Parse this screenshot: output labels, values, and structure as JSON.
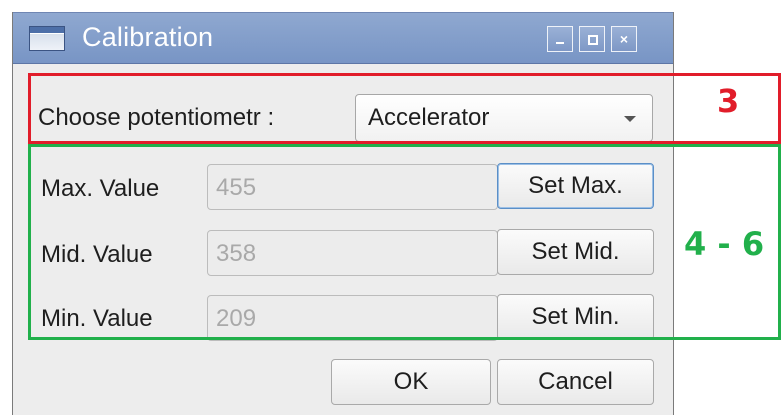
{
  "window": {
    "title": "Calibration",
    "controls": {
      "minimize": "minimize",
      "maximize": "maximize",
      "close": "×"
    }
  },
  "potentiometer": {
    "label": "Choose potentiometr :",
    "selected": "Accelerator"
  },
  "values": [
    {
      "label": "Max. Value",
      "value": "455",
      "button": "Set Max."
    },
    {
      "label": "Mid. Value",
      "value": "358",
      "button": "Set Mid."
    },
    {
      "label": "Min. Value",
      "value": "209",
      "button": "Set Min."
    }
  ],
  "footer": {
    "ok": "OK",
    "cancel": "Cancel"
  },
  "annotations": {
    "section_combo": "3",
    "section_values": "4 - 6",
    "combo_color": "#e11d2a",
    "values_color": "#21b04b"
  },
  "colors": {
    "titlebar": "#7e98c6",
    "dialog_background": "#ededed",
    "focus_border": "#5b8fc7"
  }
}
